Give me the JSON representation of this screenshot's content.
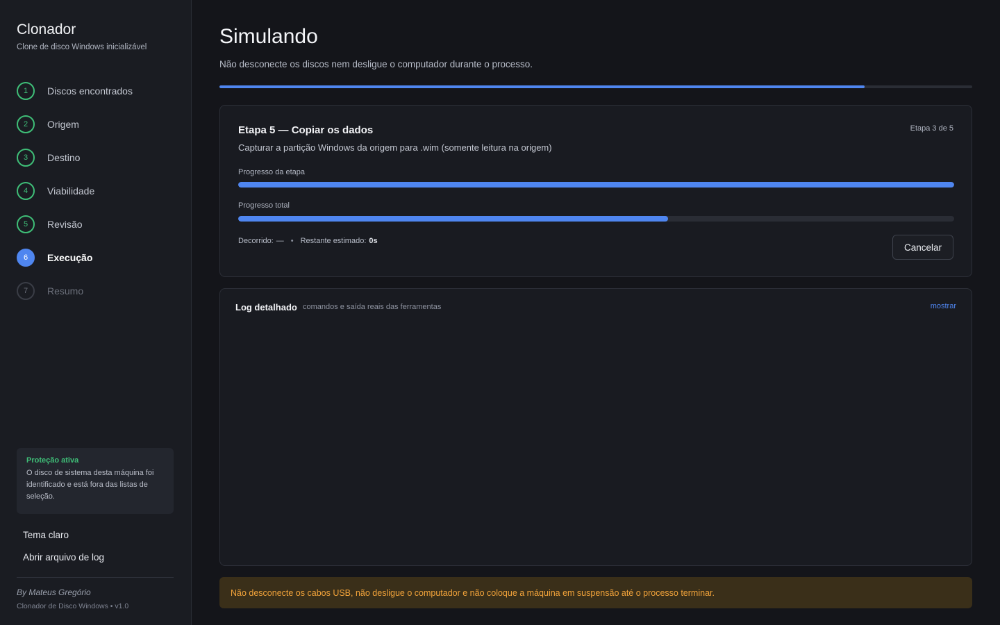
{
  "sidebar": {
    "title": "Clonador",
    "subtitle": "Clone de disco Windows inicializável",
    "steps": [
      {
        "num": "1",
        "label": "Discos encontrados",
        "state": "done"
      },
      {
        "num": "2",
        "label": "Origem",
        "state": "done"
      },
      {
        "num": "3",
        "label": "Destino",
        "state": "done"
      },
      {
        "num": "4",
        "label": "Viabilidade",
        "state": "done"
      },
      {
        "num": "5",
        "label": "Revisão",
        "state": "done"
      },
      {
        "num": "6",
        "label": "Execução",
        "state": "active"
      },
      {
        "num": "7",
        "label": "Resumo",
        "state": "pending"
      }
    ],
    "protection": {
      "title": "Proteção ativa",
      "text": "O disco de sistema desta máquina foi identificado e está fora das listas de seleção."
    },
    "theme_toggle": "Tema claro",
    "open_log": "Abrir arquivo de log",
    "author": "By Mateus Gregório",
    "version": "Clonador de Disco Windows • v1.0"
  },
  "main": {
    "title": "Simulando",
    "subtitle": "Não desconecte os discos nem desligue o computador durante o processo.",
    "overall_progress": 0.857,
    "step_card": {
      "title": "Etapa 5 — Copiar os dados",
      "step_count": "Etapa 3 de 5",
      "description": "Capturar a partição Windows da origem para .wim (somente leitura na origem)",
      "step_progress_label": "Progresso da etapa",
      "step_progress": 1.0,
      "total_progress_label": "Progresso total",
      "total_progress": 0.6,
      "elapsed_label": "Decorrido:",
      "elapsed_value": "—",
      "separator": "•",
      "remaining_label": "Restante estimado:",
      "remaining_value": "0s",
      "cancel_label": "Cancelar"
    },
    "log": {
      "title": "Log detalhado",
      "subtitle": "comandos e saída reais das ferramentas",
      "toggle": "mostrar"
    },
    "warning": "Não desconecte os cabos USB, não desligue o computador e não coloque a máquina em suspensão até o processo terminar."
  },
  "colors": {
    "accent": "#4f86f0",
    "success": "#3fbf78",
    "warning_text": "#f2a33a",
    "warning_bg": "#3a2f19"
  }
}
